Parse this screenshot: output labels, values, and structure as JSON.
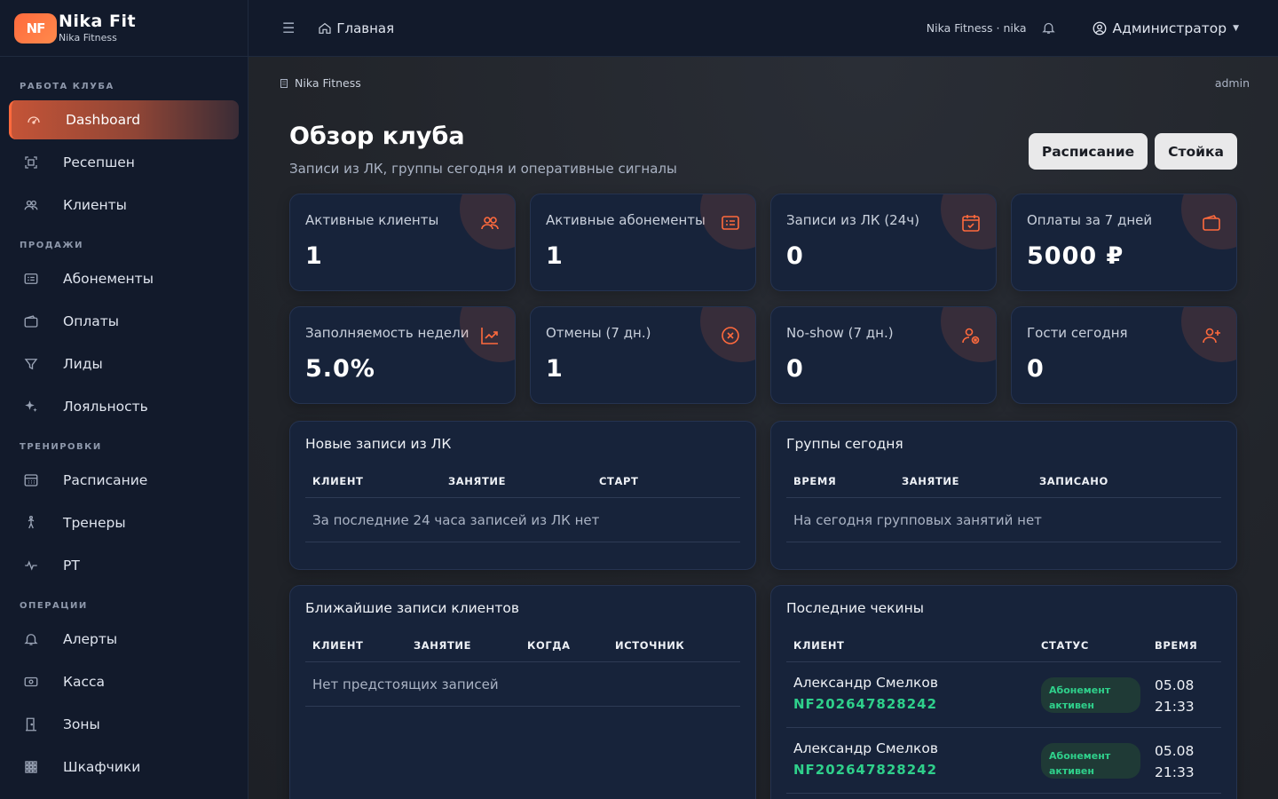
{
  "brand": {
    "logo_text": "NF",
    "name": "Nika Fit",
    "subtitle": "Nika Fitness"
  },
  "sidebar": {
    "sections": [
      {
        "title": "РАБОТА КЛУБА",
        "items": [
          {
            "label": "Dashboard",
            "icon": "gauge-icon",
            "active": true
          },
          {
            "label": "Ресепшен",
            "icon": "scan-icon"
          },
          {
            "label": "Клиенты",
            "icon": "users-icon"
          }
        ]
      },
      {
        "title": "ПРОДАЖИ",
        "items": [
          {
            "label": "Абонементы",
            "icon": "card-list-icon"
          },
          {
            "label": "Оплаты",
            "icon": "wallet-icon"
          },
          {
            "label": "Лиды",
            "icon": "funnel-icon"
          },
          {
            "label": "Лояльность",
            "icon": "sparkle-icon"
          }
        ]
      },
      {
        "title": "ТРЕНИРОВКИ",
        "items": [
          {
            "label": "Расписание",
            "icon": "calendar-grid-icon"
          },
          {
            "label": "Тренеры",
            "icon": "person-running-icon"
          },
          {
            "label": "PT",
            "icon": "pulse-icon"
          }
        ]
      },
      {
        "title": "ОПЕРАЦИИ",
        "items": [
          {
            "label": "Алерты",
            "icon": "bell-icon"
          },
          {
            "label": "Касса",
            "icon": "cash-icon"
          },
          {
            "label": "Зоны",
            "icon": "door-icon"
          },
          {
            "label": "Шкафчики",
            "icon": "lockers-grid-icon"
          }
        ]
      }
    ]
  },
  "topbar": {
    "menu_icon": "hamburger-icon",
    "home_label": "Главная",
    "org_label": "Nika Fitness · nika",
    "admin_label": "Администратор"
  },
  "page": {
    "breadcrumb": "Nika Fitness",
    "user": "admin",
    "title": "Обзор клуба",
    "subtitle": "Записи из ЛК, группы сегодня и оперативные сигналы",
    "actions": {
      "schedule": "Расписание",
      "desk": "Стойка"
    }
  },
  "stats": [
    {
      "label": "Активные клиенты",
      "value": "1",
      "icon": "users-icon"
    },
    {
      "label": "Активные абонементы",
      "value": "1",
      "icon": "card-list-icon"
    },
    {
      "label": "Записи из ЛК (24ч)",
      "value": "0",
      "icon": "calendar-check-icon"
    },
    {
      "label": "Оплаты за 7 дней",
      "value": "5000 ₽",
      "icon": "wallet-icon"
    },
    {
      "label": "Заполняемость недели",
      "value": "5.0%",
      "icon": "chart-up-icon"
    },
    {
      "label": "Отмены (7 дн.)",
      "value": "1",
      "icon": "x-circle-icon"
    },
    {
      "label": "No-show (7 дн.)",
      "value": "0",
      "icon": "person-x-icon"
    },
    {
      "label": "Гости сегодня",
      "value": "0",
      "icon": "person-plus-icon"
    }
  ],
  "panels": {
    "new_bookings": {
      "title": "Новые записи из ЛК",
      "columns": [
        "КЛИЕНТ",
        "ЗАНЯТИЕ",
        "СТАРТ"
      ],
      "empty": "За последние 24 часа записей из ЛК нет"
    },
    "groups_today": {
      "title": "Группы сегодня",
      "columns": [
        "ВРЕМЯ",
        "ЗАНЯТИЕ",
        "ЗАПИСАНО"
      ],
      "empty": "На сегодня групповых занятий нет"
    },
    "upcoming": {
      "title": "Ближайшие записи клиентов",
      "columns": [
        "КЛИЕНТ",
        "ЗАНЯТИЕ",
        "КОГДА",
        "ИСТОЧНИК"
      ],
      "empty": "Нет предстоящих записей"
    },
    "checkins": {
      "title": "Последние чекины",
      "columns": [
        "КЛИЕНТ",
        "СТАТУС",
        "ВРЕМЯ"
      ],
      "rows": [
        {
          "name": "Александр Смелков",
          "code": "NF202647828242",
          "status_line1": "Абонемент",
          "status_line2": "активен",
          "date": "05.08",
          "time": "21:33"
        },
        {
          "name": "Александр Смелков",
          "code": "NF202647828242",
          "status_line1": "Абонемент",
          "status_line2": "активен",
          "date": "05.08",
          "time": "21:33"
        }
      ]
    }
  },
  "colors": {
    "accent": "#ff6a3d",
    "success": "#2fd08b",
    "sidebar_bg": "#121a2b",
    "card_bg": "#17233a"
  }
}
